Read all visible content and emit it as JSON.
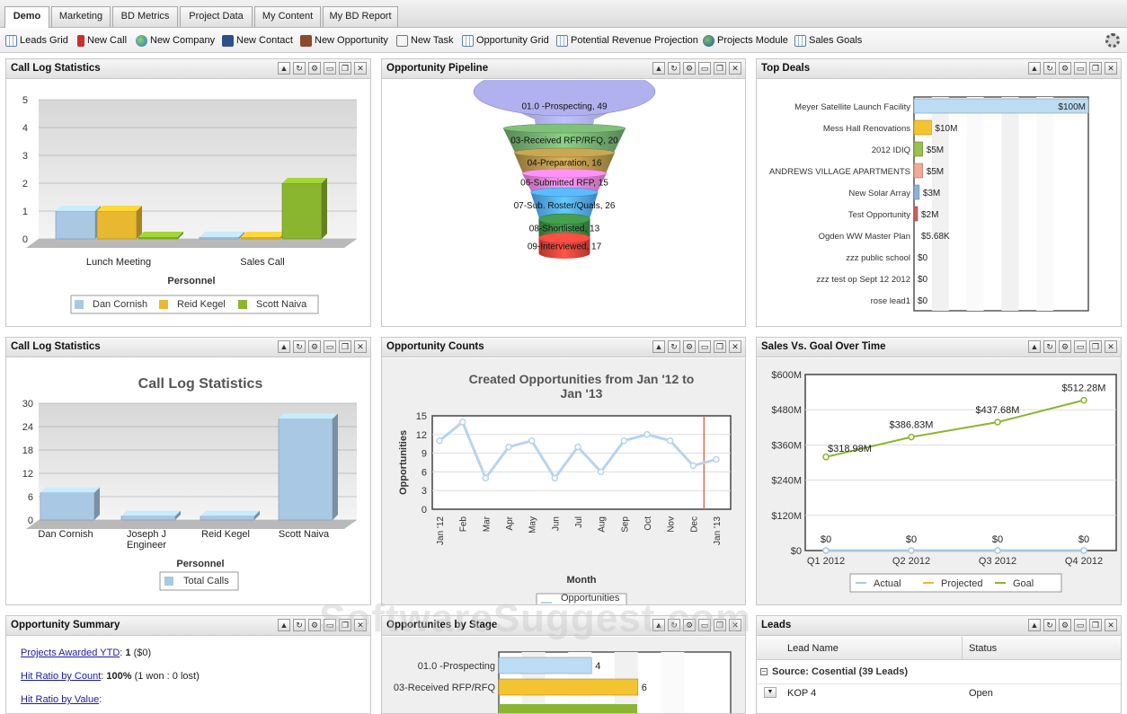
{
  "tabs": [
    "Demo",
    "Marketing",
    "BD Metrics",
    "Project Data",
    "My Content",
    "My BD Report"
  ],
  "toolbar": {
    "items": [
      {
        "label": "Leads Grid",
        "icon": "grid-icon"
      },
      {
        "label": "New Call",
        "icon": "phone-icon"
      },
      {
        "label": "New Company",
        "icon": "globe-icon"
      },
      {
        "label": "New Contact",
        "icon": "contact-card-icon"
      },
      {
        "label": "New Opportunity",
        "icon": "briefcase-icon"
      },
      {
        "label": "New Task",
        "icon": "task-list-icon"
      },
      {
        "label": "Opportunity Grid",
        "icon": "grid-icon"
      },
      {
        "label": "Potential Revenue Projection",
        "icon": "grid-icon"
      },
      {
        "label": "Projects Module",
        "icon": "earth-icon"
      },
      {
        "label": "Sales Goals",
        "icon": "grid-icon"
      }
    ]
  },
  "panels": {
    "call_log_1": {
      "title": "Call Log Statistics"
    },
    "pipeline": {
      "title": "Opportunity Pipeline"
    },
    "top_deals": {
      "title": "Top Deals"
    },
    "call_log_2": {
      "title": "Call Log Statistics"
    },
    "counts": {
      "title": "Opportunity Counts"
    },
    "sales_goal": {
      "title": "Sales Vs. Goal Over Time"
    },
    "summary": {
      "title": "Opportunity Summary",
      "lines": [
        {
          "link": "Projects Awarded YTD",
          "sep": ": ",
          "bold": "1",
          "rest": " ($0)"
        },
        {
          "link": "Hit Ratio by Count",
          "sep": ": ",
          "bold": "100%",
          "rest": " (1 won : 0 lost)"
        },
        {
          "link": "Hit Ratio by Value",
          "sep": ": ",
          "bold": "",
          "rest": ""
        }
      ]
    },
    "by_stage": {
      "title": "Opportunites by Stage"
    },
    "leads": {
      "title": "Leads",
      "columns": [
        "Lead Name",
        "Status"
      ],
      "group": "Source: Cosential (39 Leads)",
      "rows": [
        {
          "name": "KOP 4",
          "status": "Open"
        }
      ]
    }
  },
  "chart_data": [
    {
      "type": "bar",
      "id": "call_log_1",
      "categories": [
        "Lunch Meeting",
        "Sales Call"
      ],
      "xlabel": "Personnel",
      "ylim": [
        0,
        5
      ],
      "yticks": [
        0,
        1,
        2,
        3,
        4,
        5
      ],
      "series": [
        {
          "name": "Dan Cornish",
          "values": [
            1,
            0
          ],
          "color": "#a9c8e4"
        },
        {
          "name": "Reid Kegel",
          "values": [
            1,
            0
          ],
          "color": "#e8b830"
        },
        {
          "name": "Scott Naiva",
          "values": [
            0,
            2
          ],
          "color": "#8ab52e"
        }
      ]
    },
    {
      "type": "funnel",
      "id": "pipeline",
      "labels": [
        "01.0 -Prospecting, 49",
        "03-Received RFP/RFQ, 20",
        "04-Preparation, 16",
        "06-Submitted RFP, 15",
        "07-Sub. Roster/Quals, 26",
        "08-Shortlisted, 13",
        "09-Interviewed, 17"
      ],
      "values": [
        49,
        20,
        16,
        15,
        26,
        13,
        17
      ],
      "colors": [
        "#9a9ad0",
        "#6fa86a",
        "#b09148",
        "#e77fd6",
        "#4fa3ef",
        "#3b8a44",
        "#e0443a"
      ]
    },
    {
      "type": "bar",
      "id": "top_deals",
      "orientation": "horizontal",
      "categories": [
        "Meyer Satellite Launch Facility",
        "Mess Hall Renovations",
        "2012 IDIQ",
        "ANDREWS VILLAGE APARTMENTS",
        "New Solar Array",
        "Test Opportunity",
        "Ogden WW Master Plan",
        "zzz public school",
        "zzz test op Sept 12 2012",
        "rose lead1"
      ],
      "values": [
        100000000,
        10000000,
        5000000,
        5000000,
        3000000,
        2000000,
        5680,
        0,
        0,
        0
      ],
      "value_labels": [
        "$100M",
        "$10M",
        "$5M",
        "$5M",
        "$3M",
        "$2M",
        "$5.68K",
        "$0",
        "$0",
        "$0"
      ],
      "colors": [
        "#bcdcf4",
        "#f4c430",
        "#9bc04b",
        "#f4a896",
        "#8ab4e0",
        "#d0605a",
        "#cccccc",
        "#cccccc",
        "#cccccc",
        "#cccccc"
      ]
    },
    {
      "type": "bar",
      "id": "call_log_2",
      "title": "Call Log Statistics",
      "categories": [
        "Dan Cornish",
        "Joseph J Engineer",
        "Reid Kegel",
        "Scott Naiva"
      ],
      "xlabel": "Personnel",
      "ylim": [
        0,
        30
      ],
      "yticks": [
        0,
        6,
        12,
        18,
        24,
        30
      ],
      "series": [
        {
          "name": "Total Calls",
          "values": [
            7,
            1,
            1,
            26
          ],
          "color": "#a9c8e4"
        }
      ]
    },
    {
      "type": "line",
      "id": "counts",
      "title": "Created Opportunities from Jan '12 to Jan '13",
      "xlabel": "Month",
      "ylabel": "Opportunities",
      "ylim": [
        0,
        15
      ],
      "yticks": [
        0,
        3,
        6,
        9,
        12,
        15
      ],
      "categories": [
        "Jan '12",
        "Feb",
        "Mar",
        "Apr",
        "May",
        "Jun",
        "Jul",
        "Aug",
        "Sep",
        "Oct",
        "Nov",
        "Dec",
        "Jan '13"
      ],
      "series": [
        {
          "name": "Opportunities",
          "values": [
            11,
            14,
            5,
            10,
            11,
            5,
            10,
            6,
            11,
            12,
            11,
            7,
            8
          ],
          "color": "#b8d4ee"
        }
      ]
    },
    {
      "type": "line",
      "id": "sales_goal",
      "categories": [
        "Q1 2012",
        "Q2 2012",
        "Q3 2012",
        "Q4 2012"
      ],
      "ylim": [
        0,
        600000000
      ],
      "yticks": [
        "$0",
        "$120M",
        "$240M",
        "$360M",
        "$480M",
        "$600M"
      ],
      "series": [
        {
          "name": "Actual",
          "values": [
            0,
            0,
            0,
            0
          ],
          "labels": [
            "$0",
            "$0",
            "$0",
            "$0"
          ],
          "color": "#a9c8e4"
        },
        {
          "name": "Projected",
          "values": [
            0,
            0,
            0,
            0
          ],
          "color": "#e8b830"
        },
        {
          "name": "Goal",
          "values": [
            318980000,
            386830000,
            437680000,
            512280000
          ],
          "labels": [
            "$318.98M",
            "$386.83M",
            "$437.68M",
            "$512.28M"
          ],
          "color": "#8ab52e"
        }
      ]
    },
    {
      "type": "bar",
      "id": "by_stage",
      "orientation": "horizontal",
      "categories": [
        "01.0 -Prospecting",
        "03-Received RFP/RFQ"
      ],
      "values": [
        4,
        6
      ],
      "colors": [
        "#bcdcf4",
        "#f4c430"
      ]
    }
  ],
  "watermark": "SoftwareSuggest.com"
}
